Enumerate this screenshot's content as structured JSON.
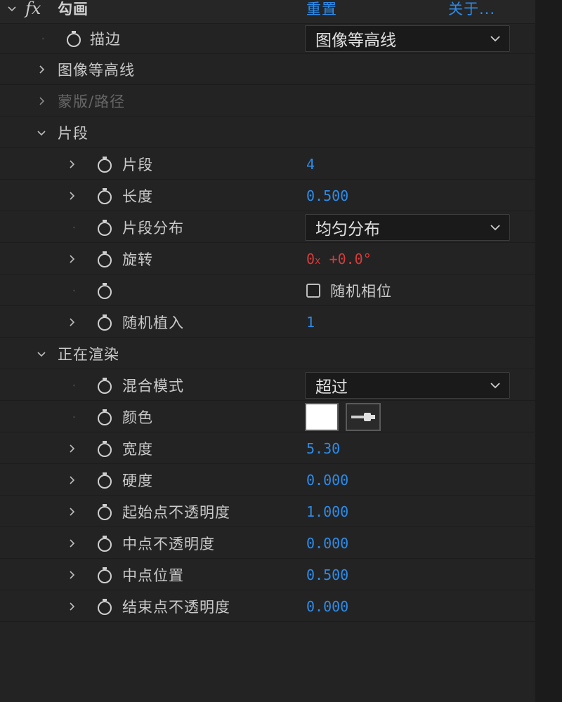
{
  "effect": {
    "name": "勾画",
    "reset_label": "重置",
    "about_label": "关于..."
  },
  "stroke": {
    "label": "描边",
    "value": "图像等高线"
  },
  "groups": {
    "image_contour": "图像等高线",
    "mask_path": "蒙版/路径",
    "segments": "片段",
    "rendering": "正在渲染"
  },
  "segments": {
    "segments_label": "片段",
    "segments_value": "4",
    "length_label": "长度",
    "length_value": "0.500",
    "distribution_label": "片段分布",
    "distribution_value": "均匀分布",
    "rotation_label": "旋转",
    "rotation_turns": "0",
    "rotation_x": "x",
    "rotation_degrees": "+0.0°",
    "random_phase_label": "随机相位",
    "random_phase_checked": false,
    "random_seed_label": "随机植入",
    "random_seed_value": "1"
  },
  "rendering": {
    "blend_mode_label": "混合模式",
    "blend_mode_value": "超过",
    "color_label": "颜色",
    "color_value": "#ffffff",
    "width_label": "宽度",
    "width_value": "5.30",
    "hardness_label": "硬度",
    "hardness_value": "0.000",
    "start_opacity_label": "起始点不透明度",
    "start_opacity_value": "1.000",
    "mid_opacity_label": "中点不透明度",
    "mid_opacity_value": "0.000",
    "mid_position_label": "中点位置",
    "mid_position_value": "0.500",
    "end_opacity_label": "结束点不透明度",
    "end_opacity_value": "0.000"
  },
  "colors": {
    "value_blue": "#2d8ceb",
    "value_red": "#d43c3c",
    "panel_bg": "#232323"
  }
}
